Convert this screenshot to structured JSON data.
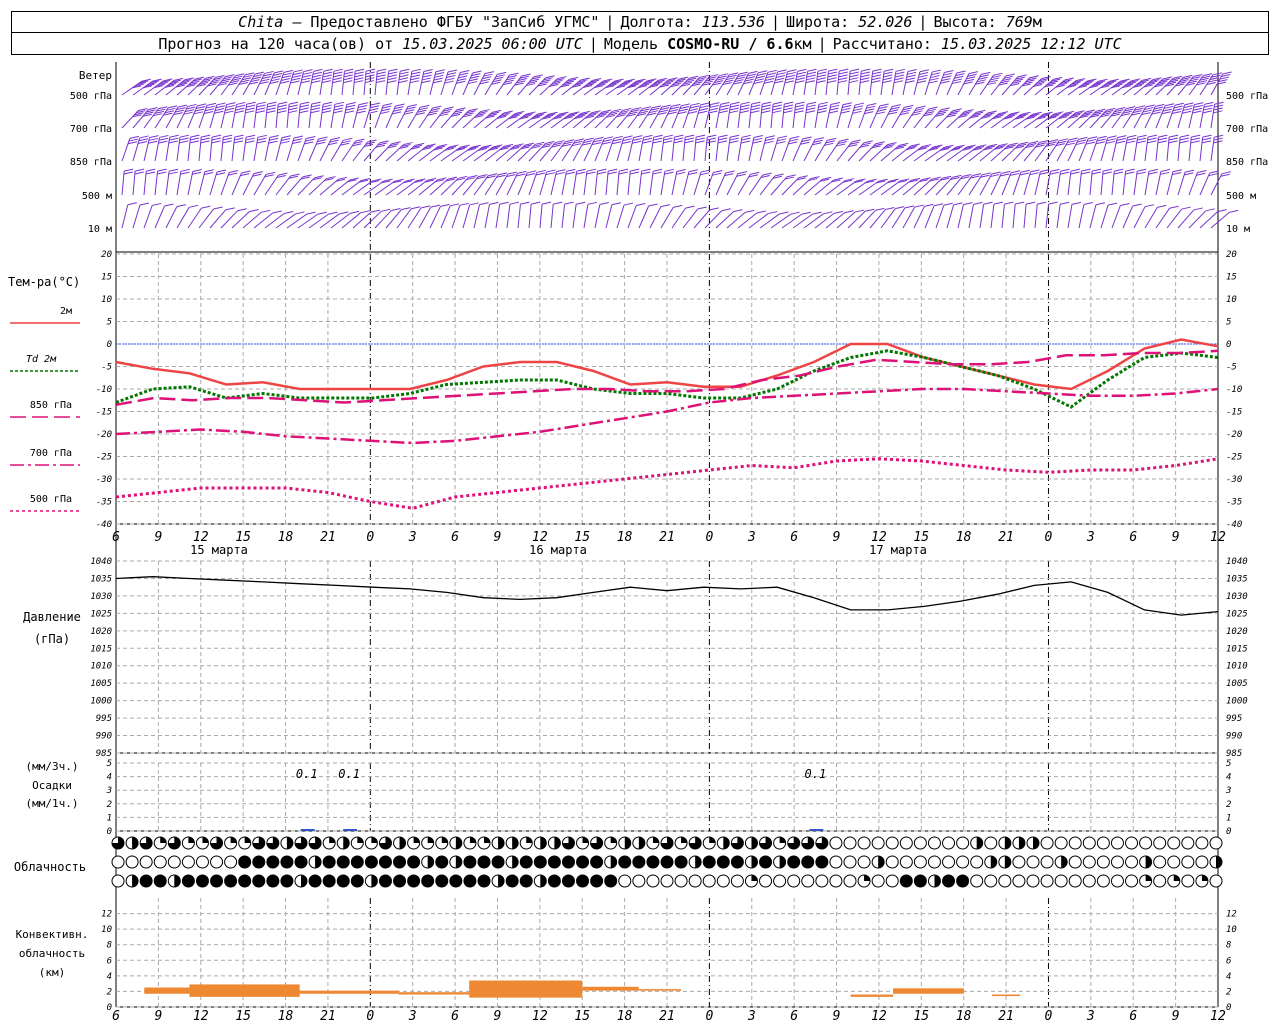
{
  "header": {
    "station": "Chita",
    "provider": "— Предоставлено ФГБУ \"ЗапСиб УГМС\"",
    "lon_label": "Долгота:",
    "lon": "113.536",
    "lat_label": "Широта:",
    "lat": "52.026",
    "alt_label": "Высота:",
    "alt": "769",
    "alt_unit": "м",
    "forecast_label": "Прогноз на 120 часа(ов) от",
    "forecast_time": "15.03.2025 06:00 UTC",
    "model_label": "Модель",
    "model": "COSMO-RU / 6.6",
    "model_unit": "км",
    "computed_label": "Рассчитано:",
    "computed_time": "15.03.2025 12:12 UTC"
  },
  "colors": {
    "t2m": "#ee4444",
    "td2m": "#007700",
    "t850": "#dd1177",
    "t700": "#dd1177",
    "t500": "#dd1177",
    "wind": "#7733cc",
    "conv": "#ee8833",
    "precip": "#3355cc",
    "zero_line": "#3355ff"
  },
  "chart_data": [
    {
      "type": "wind_barbs",
      "panel_label": "Ветер",
      "levels": [
        "500 гПа",
        "700 гПа",
        "850 гПа",
        "500 м",
        "10  м"
      ],
      "level_speed_kt": [
        55,
        35,
        25,
        20,
        5
      ]
    },
    {
      "type": "line",
      "panel_label": "Тем-ра(°C)",
      "ylim": [
        -40,
        20
      ],
      "yticks": [
        20,
        15,
        10,
        5,
        0,
        -5,
        -10,
        -15,
        -20,
        -25,
        -30,
        -35,
        -40
      ],
      "hour_ticks": [
        "6",
        "9",
        "12",
        "15",
        "18",
        "21",
        "0",
        "3",
        "6",
        "9",
        "12",
        "15",
        "18",
        "21",
        "0",
        "3",
        "6",
        "9",
        "12",
        "15",
        "18",
        "21",
        "0",
        "3",
        "6",
        "9",
        "12"
      ],
      "day_labels": [
        "15 марта",
        "16 марта",
        "17 марта"
      ],
      "series": [
        {
          "name": "2м",
          "style": "solid",
          "t": [
            0,
            3,
            6,
            9,
            12,
            15,
            18,
            21,
            24,
            27,
            30,
            33,
            36,
            39,
            42,
            45,
            48,
            51,
            54,
            57,
            60,
            63,
            66,
            69,
            72,
            75,
            78
          ],
          "values": [
            -4,
            -5.5,
            -6.5,
            -9,
            -8.5,
            -10,
            -10,
            -10,
            -10,
            -8,
            -5,
            -4,
            -4,
            -6,
            -9,
            -8.5,
            -9.5,
            -9.5,
            -7,
            -4,
            0,
            0,
            -3,
            -5,
            -7,
            -9,
            -10,
            -6,
            -1,
            1,
            -0.5
          ]
        },
        {
          "name": "Td 2м",
          "style": "dotted",
          "t": [
            0,
            3,
            6,
            9,
            12,
            15,
            18,
            21,
            24,
            27,
            30,
            33,
            36,
            39,
            42,
            45,
            48,
            51,
            54,
            57,
            60,
            63,
            66,
            69,
            72,
            75,
            78
          ],
          "values": [
            -13,
            -10,
            -9.5,
            -12,
            -11,
            -12,
            -12,
            -12,
            -11,
            -9,
            -8.5,
            -8,
            -8,
            -10,
            -11,
            -11,
            -12,
            -12,
            -10,
            -6,
            -3,
            -1.5,
            -3,
            -5,
            -7,
            -10,
            -14,
            -8,
            -3,
            -2,
            -3
          ]
        },
        {
          "name": "850 гПа",
          "style": "dashed",
          "t": [
            0,
            3,
            6,
            9,
            12,
            15,
            18,
            21,
            24,
            27,
            30,
            33,
            36,
            39,
            42,
            45,
            48,
            51,
            54,
            57,
            60,
            63,
            66,
            69,
            72,
            75,
            78
          ],
          "values": [
            -13.5,
            -12,
            -12.5,
            -12,
            -12,
            -12.5,
            -13,
            -12.5,
            -12,
            -11.5,
            -11,
            -10.5,
            -10,
            -10,
            -10.5,
            -10.5,
            -10,
            -8,
            -7,
            -5,
            -3.5,
            -4,
            -4.5,
            -4.5,
            -4,
            -2.5,
            -2.5,
            -2,
            -2,
            -1.5
          ]
        },
        {
          "name": "700 гПа",
          "style": "dashdot",
          "t": [
            0,
            3,
            6,
            9,
            12,
            15,
            18,
            21,
            24,
            27,
            30,
            33,
            36,
            39,
            42,
            45,
            48,
            51,
            54,
            57,
            60,
            63,
            66,
            69,
            72,
            75,
            78
          ],
          "values": [
            -20,
            -19.5,
            -19,
            -19.5,
            -20.5,
            -21,
            -21.5,
            -22,
            -21.5,
            -20.5,
            -19.5,
            -18,
            -16.5,
            -15,
            -13,
            -12,
            -11.5,
            -11,
            -10.5,
            -10,
            -10,
            -10.5,
            -11,
            -11.5,
            -11.5,
            -11,
            -10
          ]
        },
        {
          "name": "500 гПа",
          "style": "dotted",
          "t": [
            0,
            3,
            6,
            9,
            12,
            15,
            18,
            21,
            24,
            27,
            30,
            33,
            36,
            39,
            42,
            45,
            48,
            51,
            54,
            57,
            60,
            63,
            66,
            69,
            72,
            75,
            78
          ],
          "values": [
            -34,
            -33,
            -32,
            -32,
            -32,
            -33,
            -35,
            -36.5,
            -34,
            -33,
            -32,
            -31,
            -30,
            -29,
            -28,
            -27,
            -27.5,
            -26,
            -25.5,
            -26,
            -27,
            -28,
            -28.5,
            -28,
            -28,
            -27,
            -25.5
          ]
        }
      ]
    },
    {
      "type": "line",
      "panel_label_1": "Давление",
      "panel_label_2": "(гПа)",
      "ylim": [
        985,
        1040
      ],
      "yticks": [
        1040,
        1035,
        1030,
        1025,
        1020,
        1015,
        1010,
        1005,
        1000,
        995,
        990,
        985
      ],
      "series": [
        {
          "t": [
            0,
            3,
            6,
            9,
            12,
            15,
            18,
            21,
            24,
            27,
            30,
            33,
            36,
            39,
            42,
            45,
            48,
            51,
            54,
            57,
            60,
            63,
            66,
            69,
            72,
            75,
            78
          ],
          "values": [
            1035,
            1035.5,
            1035,
            1034.5,
            1034,
            1033.5,
            1033,
            1032.5,
            1032,
            1031,
            1029.5,
            1029,
            1029.5,
            1031,
            1032.5,
            1031.5,
            1032.5,
            1032,
            1032.5,
            1029.5,
            1026,
            1026,
            1027,
            1028.5,
            1030.5,
            1033,
            1034,
            1031,
            1026,
            1024.5,
            1025.5
          ]
        }
      ]
    },
    {
      "type": "bar",
      "panel_label_1": "(мм/3ч.)",
      "panel_label_2": "Осадки",
      "panel_label_3": "(мм/1ч.)",
      "ylim": [
        0,
        5
      ],
      "yticks": [
        5,
        4,
        3,
        2,
        1,
        0
      ],
      "annotations": [
        {
          "t": 13.5,
          "label": "0.1"
        },
        {
          "t": 16.5,
          "label": "0.1"
        },
        {
          "t": 49.5,
          "label": "0.1"
        }
      ]
    },
    {
      "type": "cloud_cover",
      "panel_label": "Облачность",
      "rows": 3
    },
    {
      "type": "bar",
      "panel_label_1": "Конвективн.",
      "panel_label_2": "облачность",
      "panel_label_3": "(км)",
      "ylim": [
        0,
        14
      ],
      "yticks": [
        12,
        10,
        8,
        6,
        4,
        2,
        0
      ]
    }
  ]
}
